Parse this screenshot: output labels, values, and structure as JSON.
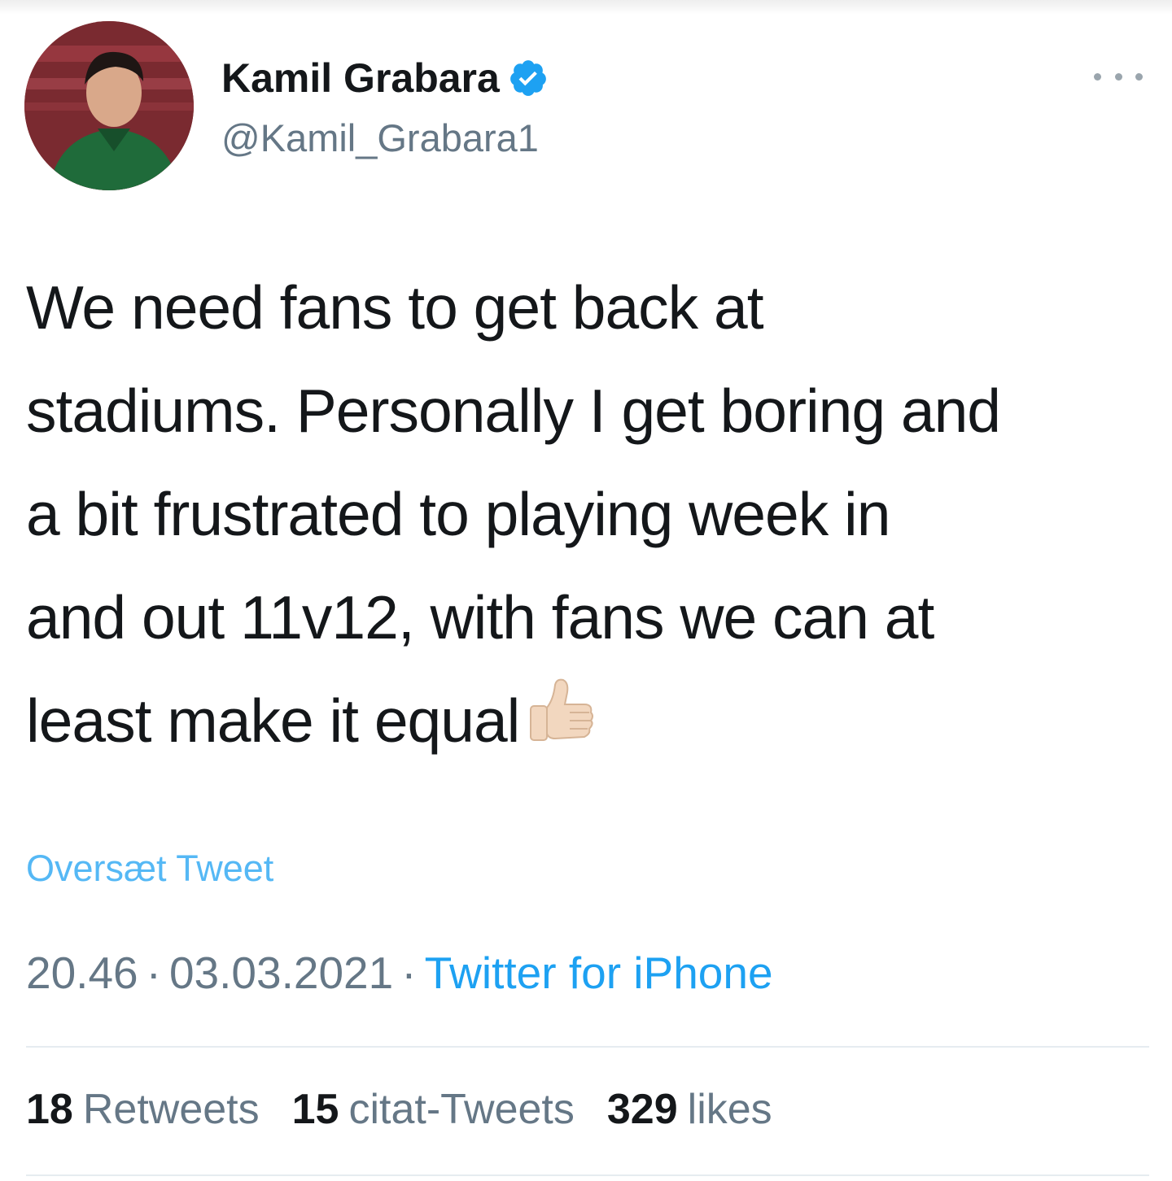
{
  "author": {
    "display_name": "Kamil Grabara",
    "handle": "@Kamil_Grabara1",
    "verified": true
  },
  "tweet": {
    "lines": [
      "We need fans to get back at",
      "stadiums. Personally I get boring and",
      "a bit frustrated to playing week in",
      "and out 11v12, with fans we can at",
      "least make it equal"
    ],
    "emoji": "thumbs-up-light-skin-tone"
  },
  "translate_label": "Oversæt Tweet",
  "meta": {
    "time": "20.46",
    "date": "03.03.2021",
    "source": "Twitter for iPhone",
    "separator": "·"
  },
  "stats": {
    "retweets": {
      "count": "18",
      "label": "Retweets"
    },
    "quotes": {
      "count": "15",
      "label": "citat-Tweets"
    },
    "likes": {
      "count": "329",
      "label": "likes"
    }
  },
  "colors": {
    "link_blue": "#1da1f2",
    "secondary_text": "#657786",
    "primary_text": "#14171a",
    "divider": "#e6ecf0"
  },
  "icons": {
    "more": "more-options-icon",
    "verified": "verified-badge-icon"
  }
}
